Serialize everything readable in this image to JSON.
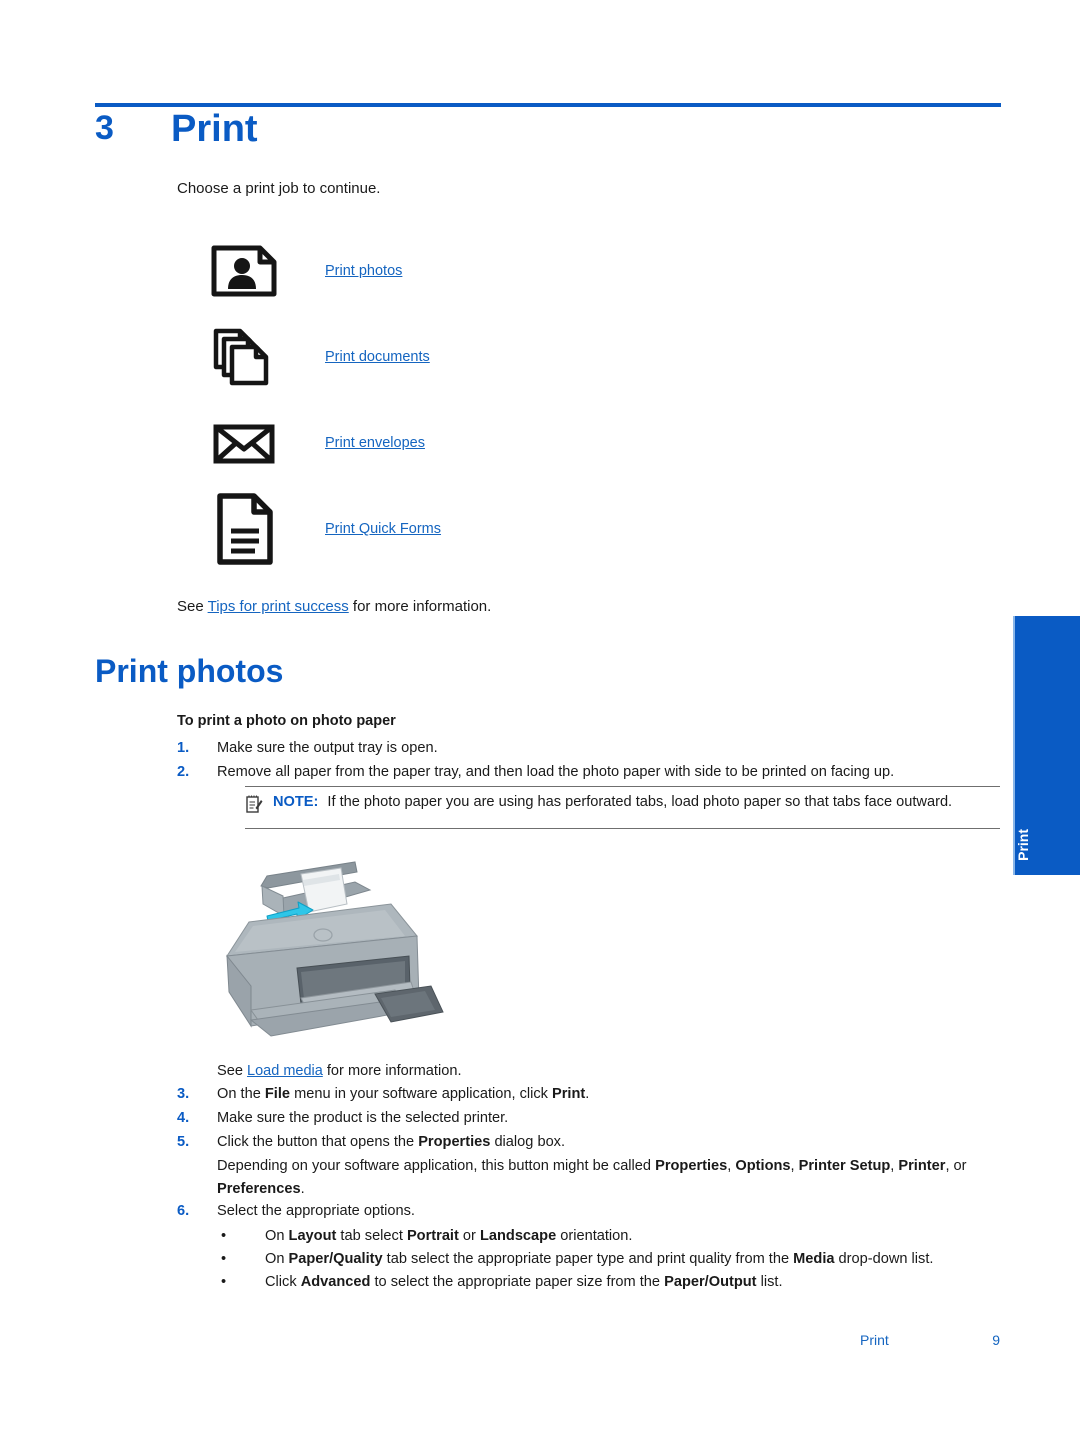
{
  "chapter": {
    "number": "3",
    "title": "Print",
    "intro": "Choose a print job to continue."
  },
  "link_list": [
    {
      "icon": "photo-page-icon",
      "label": "Print photos"
    },
    {
      "icon": "stacked-documents-icon",
      "label": "Print documents"
    },
    {
      "icon": "envelope-icon",
      "label": "Print envelopes"
    },
    {
      "icon": "form-page-icon",
      "label": "Print Quick Forms"
    }
  ],
  "see_line": {
    "prefix": "See ",
    "link": "Tips for print success",
    "suffix": " for more information."
  },
  "section": {
    "heading": "Print photos",
    "procedure_title": "To print a photo on photo paper"
  },
  "steps_upper": [
    {
      "num": "1.",
      "text": "Make sure the output tray is open."
    },
    {
      "num": "2.",
      "text": "Remove all paper from the paper tray, and then load the photo paper with side to be printed on facing up."
    }
  ],
  "note": {
    "icon": "note-pad-icon",
    "label": "NOTE:",
    "text": "If the photo paper you are using has perforated tabs, load photo paper so that tabs face outward."
  },
  "figure": {
    "name": "printer-illustration",
    "description": "HP all-in-one printer with photo paper loaded in the input tray and the output tray extended"
  },
  "see_load_media": {
    "prefix": "See ",
    "link": "Load media",
    "suffix": " for more information."
  },
  "steps_lower": [
    {
      "num": "3.",
      "html": "On the <b>File</b> menu in your software application, click <b>Print</b>."
    },
    {
      "num": "4.",
      "html": "Make sure the product is the selected printer."
    },
    {
      "num": "5.",
      "html": "Click the button that opens the <b>Properties</b> dialog box."
    }
  ],
  "depends_paragraph": "Depending on your software application, this button might be called <b>Properties</b>, <b>Options</b>, <b>Printer Setup</b>, <b>Printer</b>, or <b>Preferences</b>.",
  "step_six": {
    "num": "6.",
    "html": "Select the appropriate options."
  },
  "bullets": [
    {
      "dot": "•",
      "html": "On <b>Layout</b> tab select <b>Portrait</b> or <b>Landscape</b> orientation."
    },
    {
      "dot": "•",
      "html": "On <b>Paper/Quality</b> tab select the appropriate paper type and print quality from the <b>Media</b> drop-down list."
    },
    {
      "dot": "•",
      "html": "Click <b>Advanced</b> to select the appropriate paper size from the <b>Paper/Output</b> list."
    }
  ],
  "side_tab": {
    "label": "Print"
  },
  "footer": {
    "section": "Print",
    "page_number": "9"
  },
  "colors": {
    "accent_blue": "#0a5bc4",
    "link_blue": "#1565c0",
    "text": "#1a1a1a",
    "rule_gray": "#6f6f6f"
  }
}
